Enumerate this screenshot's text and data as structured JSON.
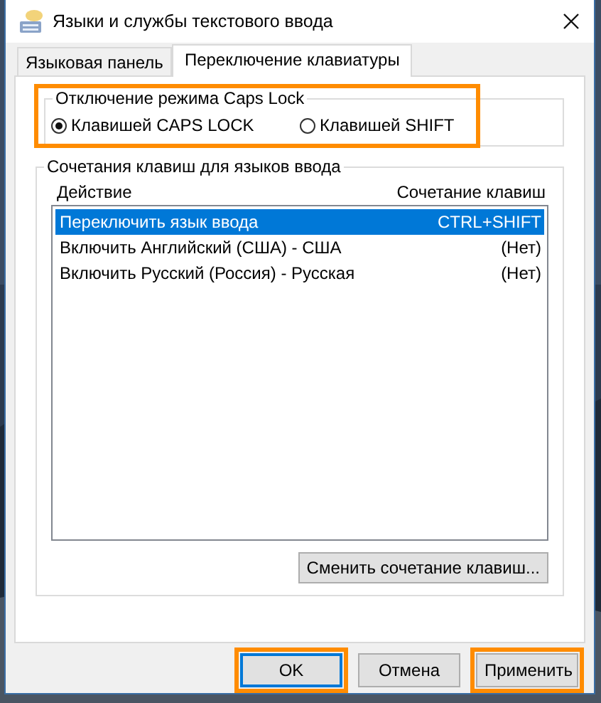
{
  "window": {
    "title": "Языки и службы текстового ввода"
  },
  "tabs": [
    {
      "label": "Языковая панель",
      "selected": false
    },
    {
      "label": "Переключение клавиатуры",
      "selected": true
    }
  ],
  "caps_lock_group": {
    "title": "Отключение режима Caps Lock",
    "highlighted": true,
    "options": [
      {
        "label": "Клавишей CAPS LOCK",
        "selected": true
      },
      {
        "label": "Клавишей SHIFT",
        "selected": false
      }
    ]
  },
  "hotkeys_group": {
    "title": "Сочетания клавиш для языков ввода",
    "columns": [
      "Действие",
      "Сочетание клавиш"
    ],
    "rows": [
      {
        "action": "Переключить язык ввода",
        "keys": "CTRL+SHIFT",
        "selected": true
      },
      {
        "action": "Включить Английский (США) - США",
        "keys": "(Нет)",
        "selected": false
      },
      {
        "action": "Включить Русский (Россия) - Русская",
        "keys": "(Нет)",
        "selected": false
      }
    ],
    "change_button": "Сменить сочетание клавиш..."
  },
  "buttons": [
    {
      "label": "OK",
      "focused": true,
      "highlighted": true
    },
    {
      "label": "Отмена",
      "focused": false,
      "highlighted": false
    },
    {
      "label": "Применить",
      "focused": false,
      "highlighted": true
    }
  ]
}
